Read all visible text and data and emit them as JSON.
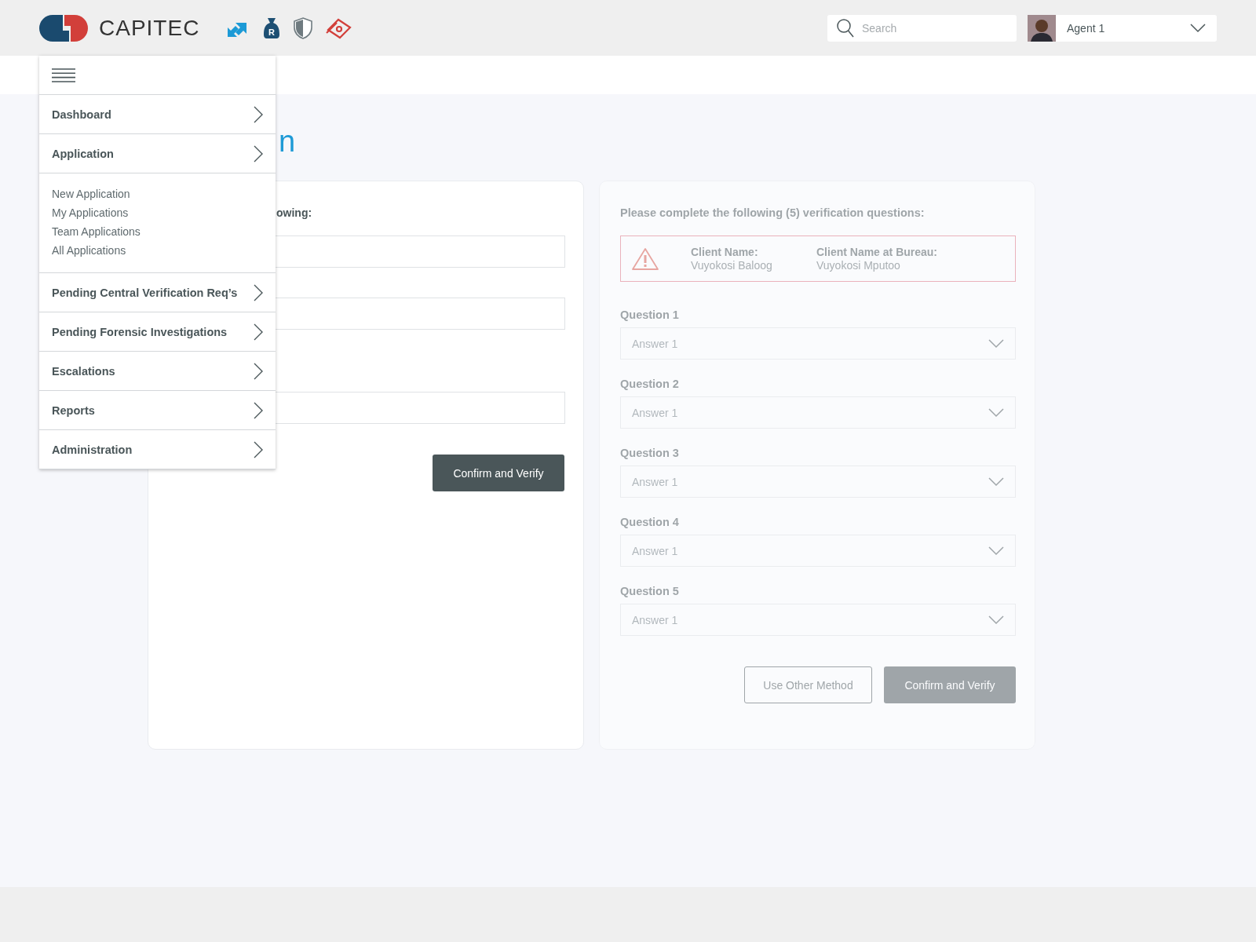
{
  "header": {
    "logo_text": "CAPITEC",
    "bag_label": "R",
    "search": {
      "placeholder": "Search"
    },
    "user": {
      "name": "Agent 1"
    }
  },
  "page_title": "n",
  "menu": {
    "items": [
      {
        "label": "Dashboard"
      },
      {
        "label": "Application",
        "children": [
          "New Application",
          "My Applications",
          "Team Applications",
          "All Applications"
        ]
      },
      {
        "label": "Pending Central Verification Req’s"
      },
      {
        "label": "Pending Forensic Investigations"
      },
      {
        "label": "Escalations"
      },
      {
        "label": "Reports"
      },
      {
        "label": "Administration"
      }
    ]
  },
  "left_card": {
    "label": "owing:",
    "button": "Confirm and Verify"
  },
  "verification": {
    "disabled": true,
    "heading": "Please complete the following (5) verification questions:",
    "alert": {
      "fields": [
        {
          "label": "Client Name:",
          "value": "Vuyokosi Baloog"
        },
        {
          "label": "Client Name at Bureau:",
          "value": "Vuyokosi Mputoo"
        }
      ]
    },
    "questions": [
      {
        "label": "Question 1",
        "answer": "Answer 1"
      },
      {
        "label": "Question 2",
        "answer": "Answer 1"
      },
      {
        "label": "Question 3",
        "answer": "Answer 1"
      },
      {
        "label": "Question 4",
        "answer": "Answer 1"
      },
      {
        "label": "Question 5",
        "answer": "Answer 1"
      }
    ],
    "buttons": [
      {
        "label": "Use Other Method",
        "kind": "secondary"
      },
      {
        "label": "Confirm and Verify",
        "kind": "primary"
      }
    ]
  }
}
